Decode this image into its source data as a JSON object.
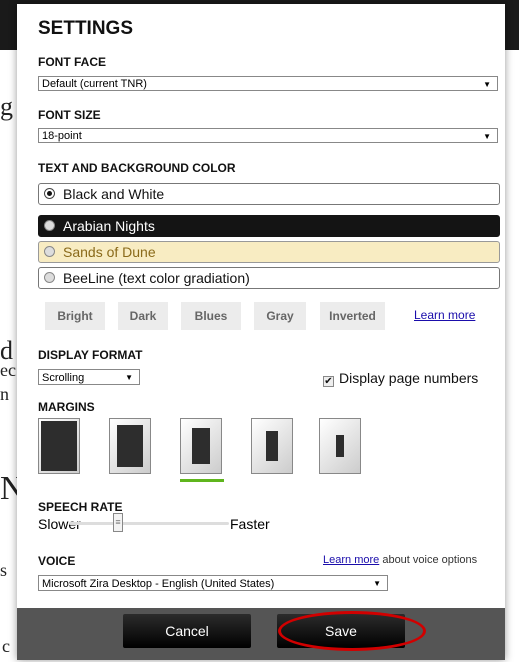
{
  "dialog": {
    "title": "SETTINGS",
    "font_face": {
      "label": "FONT FACE",
      "value": "Default (current TNR)"
    },
    "font_size": {
      "label": "FONT SIZE",
      "value": "18-point"
    },
    "color": {
      "label": "TEXT AND BACKGROUND COLOR",
      "options": [
        {
          "label": "Black and White",
          "selected": true,
          "bg": "#ffffff",
          "fg": "#111111"
        },
        {
          "label": "Arabian Nights",
          "selected": false,
          "bg": "#141414",
          "fg": "#ffffff"
        },
        {
          "label": "Sands of Dune",
          "selected": false,
          "bg": "#f8ecc2",
          "fg": "#8a6a1a"
        },
        {
          "label": "BeeLine (text color gradiation)",
          "selected": false,
          "bg": "#ffffff",
          "fg": "#111111"
        }
      ],
      "presets": [
        "Bright",
        "Dark",
        "Blues",
        "Gray",
        "Inverted"
      ],
      "learn_more": "Learn more"
    },
    "display_format": {
      "label": "DISPLAY FORMAT",
      "value": "Scrolling",
      "page_numbers_label": "Display page numbers",
      "page_numbers_checked": true
    },
    "margins": {
      "label": "MARGINS",
      "selected_index": 2
    },
    "speech_rate": {
      "label": "SPEECH RATE",
      "slower": "Slower",
      "faster": "Faster",
      "level": 0.28
    },
    "voice": {
      "label": "VOICE",
      "learn_more": "Learn more",
      "about": "about voice options",
      "value": "Microsoft Zira Desktop - English (United States)"
    },
    "buttons": {
      "cancel": "Cancel",
      "save": "Save"
    }
  },
  "background_fragments": [
    "g",
    "d",
    "ec",
    "n",
    "N",
    "s",
    "c"
  ],
  "colors": {
    "highlight_circle": "#d10000",
    "margin_underline": "#5fb51d",
    "footer": "#555555"
  }
}
